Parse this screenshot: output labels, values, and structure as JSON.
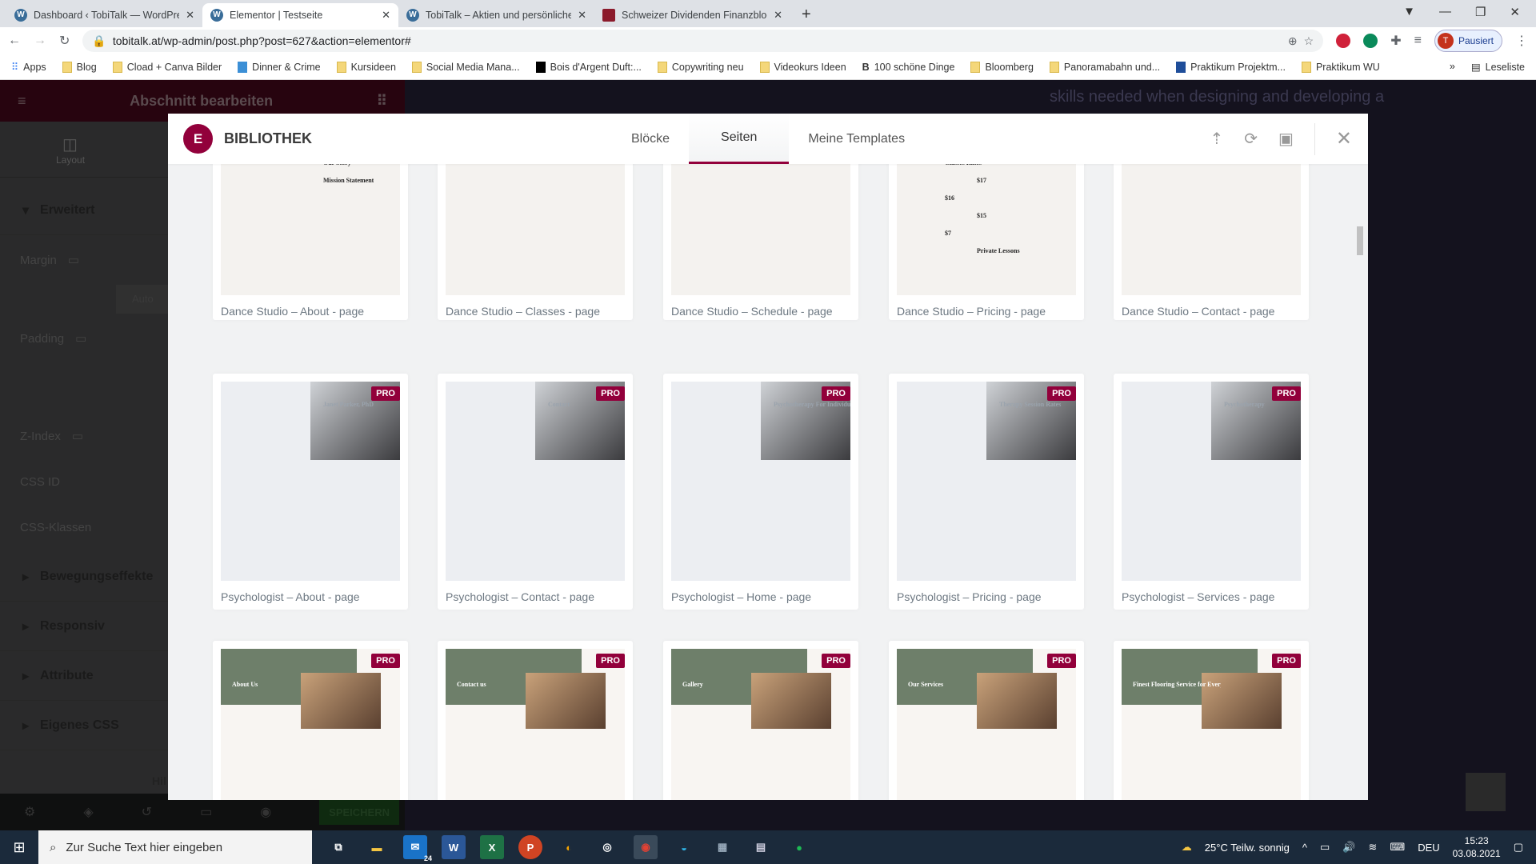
{
  "browser": {
    "tabs": [
      {
        "title": "Dashboard ‹ TobiTalk — WordPress",
        "icon": "wordpress-icon",
        "active": false
      },
      {
        "title": "Elementor | Testseite",
        "icon": "wordpress-icon",
        "active": true
      },
      {
        "title": "TobiTalk – Aktien und persönliche",
        "icon": "wordpress-icon",
        "active": false
      },
      {
        "title": "Schweizer Dividenden Finanzblog",
        "icon": "red-favicon",
        "active": false
      }
    ],
    "new_tab": "+",
    "url": "tobitalk.at/wp-admin/post.php?post=627&action=elementor#",
    "profile_initial": "T",
    "profile_label": "Pausiert",
    "bookmarks": [
      "Apps",
      "Blog",
      "Cload + Canva Bilder",
      "Dinner & Crime",
      "Kursideen",
      "Social Media Mana...",
      "Bois d'Argent Duft:...",
      "Copywriting neu",
      "Videokurs Ideen",
      "100 schöne Dinge",
      "Bloomberg",
      "Panoramabahn und...",
      "Praktikum Projektm...",
      "Praktikum WU"
    ],
    "more": "»",
    "reading_list": "Leseliste"
  },
  "panel": {
    "title": "Abschnitt bearbeiten",
    "tab": "Layout",
    "section_open": "Erweitert",
    "fields": [
      "Margin",
      "Padding",
      "Z-Index",
      "CSS ID",
      "CSS-Klassen"
    ],
    "margin_value": "Auto",
    "sections": [
      "Bewegungseffekte",
      "Responsiv",
      "Attribute",
      "Eigenes CSS"
    ],
    "help": "Hil",
    "save": "SPEICHERN"
  },
  "background": {
    "text": "skills needed when designing and developing a"
  },
  "library": {
    "logo": "E",
    "title": "BIBLIOTHEK",
    "tabs": [
      "Blöcke",
      "Seiten",
      "Meine Templates"
    ],
    "active_tab": "Seiten",
    "pro_badge": "PRO",
    "rows": [
      [
        {
          "label": "Dance Studio – About - page",
          "pro": false,
          "thumb_text": [
            "Our Story",
            "Mission Statement"
          ]
        },
        {
          "label": "Dance Studio – Classes - page",
          "pro": false,
          "thumb_text": []
        },
        {
          "label": "Dance Studio – Schedule - page",
          "pro": false,
          "thumb_text": []
        },
        {
          "label": "Dance Studio – Pricing - page",
          "pro": false,
          "thumb_text": [
            "Classes Rates",
            "$17",
            "$16",
            "$15",
            "$7",
            "Private Lessons"
          ]
        },
        {
          "label": "Dance Studio – Contact - page",
          "pro": false,
          "thumb_text": []
        }
      ],
      [
        {
          "label": "Psychologist – About - page",
          "pro": true,
          "thumb_text": [
            "Janet Parker, PhD"
          ]
        },
        {
          "label": "Psychologist – Contact - page",
          "pro": true,
          "thumb_text": [
            "Contact"
          ]
        },
        {
          "label": "Psychologist – Home - page",
          "pro": true,
          "thumb_text": [
            "Psychotherapy For Individuals, Couples & Families"
          ]
        },
        {
          "label": "Psychologist – Pricing - page",
          "pro": true,
          "thumb_text": [
            "Therapy Session Rates"
          ]
        },
        {
          "label": "Psychologist – Services - page",
          "pro": true,
          "thumb_text": [
            "Psychotherapy"
          ]
        }
      ],
      [
        {
          "label": "",
          "pro": true,
          "thumb_text": [
            "About Us"
          ]
        },
        {
          "label": "",
          "pro": true,
          "thumb_text": [
            "Contact us"
          ]
        },
        {
          "label": "",
          "pro": true,
          "thumb_text": [
            "Gallery"
          ]
        },
        {
          "label": "",
          "pro": true,
          "thumb_text": [
            "Our Services"
          ]
        },
        {
          "label": "",
          "pro": true,
          "thumb_text": [
            "Finest Flooring Service for Every Living Space & Style"
          ]
        }
      ]
    ]
  },
  "taskbar": {
    "search_placeholder": "Zur Suche Text hier eingeben",
    "mail_badge": "24",
    "weather": "25°C  Teilw. sonnig",
    "lang": "DEU",
    "time": "15:23",
    "date": "03.08.2021"
  },
  "colors": {
    "elementor_accent": "#92003b",
    "modal_bg": "#f1f2f3",
    "taskbar": "#1b2a3b"
  }
}
